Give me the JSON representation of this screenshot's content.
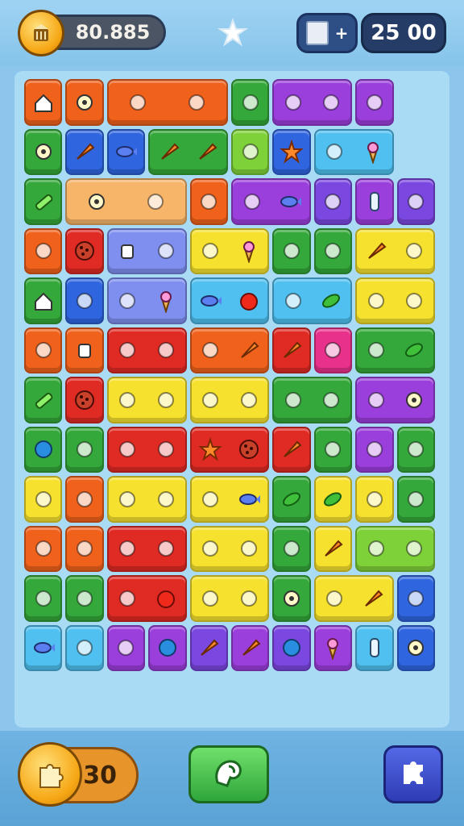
{
  "header": {
    "coins": "80.885",
    "book_count": "+",
    "score": "25 00",
    "coin_icon": "coin-basket-icon",
    "star_icon": "puzzle-star-icon",
    "book_icon": "book-icon"
  },
  "footer": {
    "hint_count": "30",
    "hint_icon": "puzzle-piece-icon",
    "shuffle_icon": "glove-icon",
    "magic_icon": "puzzle-icon"
  },
  "colors": {
    "orange": "#f0621c",
    "red": "#e02a24",
    "green": "#34a83a",
    "lime": "#7fd13a",
    "yellow": "#f5e12e",
    "purple": "#9b3fdc",
    "violet": "#7a47e0",
    "blue": "#2f66e0",
    "sky": "#4fc0ef",
    "peach": "#f7b56a",
    "periwinkle": "#7e8ff0",
    "pink": "#e8318a"
  },
  "board": {
    "rows": [
      [
        [
          "orange",
          1,
          "house-icon"
        ],
        [
          "orange",
          1,
          "gear-icon"
        ],
        [
          "orange",
          3,
          "robot-icon",
          "bar-icon"
        ],
        [
          "green",
          1,
          "apple-icon"
        ],
        [
          "purple",
          2,
          "lemon-icon",
          "wand-icon"
        ],
        [
          "purple",
          1,
          "trophy-icon"
        ]
      ],
      [
        [
          "green",
          1,
          "gear-icon"
        ],
        [
          "blue",
          1,
          "carrot-icon"
        ],
        [
          "blue",
          1,
          "fish-icon"
        ],
        [
          "green",
          2,
          "carrot-icon",
          "carrot-icon"
        ],
        [
          "lime",
          1,
          "dino-icon"
        ],
        [
          "blue",
          1,
          "star-icon"
        ],
        [
          "sky",
          2,
          "cat-icon",
          "icecream-icon"
        ]
      ],
      [
        [
          "green",
          1,
          "stick-icon"
        ],
        [
          "peach",
          3,
          "gear-icon",
          "tube-icon"
        ],
        [
          "orange",
          1,
          "shell-icon"
        ],
        [
          "purple",
          2,
          "flag-icon",
          "fish-icon"
        ],
        [
          "violet",
          1,
          "bird-icon"
        ],
        [
          "purple",
          1,
          "bottle-icon"
        ],
        [
          "violet",
          1,
          "cat-icon"
        ]
      ],
      [
        [
          "orange",
          1,
          "bandage-icon"
        ],
        [
          "red",
          1,
          "cookie-icon"
        ],
        [
          "periwinkle",
          2,
          "cup-icon",
          "pill-icon"
        ],
        [
          "yellow",
          2,
          "bug-icon",
          "icecream-icon"
        ],
        [
          "green",
          1,
          "ant-icon"
        ],
        [
          "green",
          1,
          "strawberry-icon"
        ],
        [
          "yellow",
          2,
          "carrot-icon",
          "balloon-icon"
        ]
      ],
      [
        [
          "green",
          1,
          "house-icon"
        ],
        [
          "blue",
          1,
          "jar-icon"
        ],
        [
          "periwinkle",
          2,
          "chili-icon",
          "icecream-icon"
        ],
        [
          "sky",
          2,
          "fish-icon",
          "tomato-icon"
        ],
        [
          "sky",
          2,
          "dino-icon",
          "leaf-icon"
        ],
        [
          "yellow",
          2,
          "key-icon",
          "sock-icon"
        ]
      ],
      [
        [
          "orange",
          1,
          "tube-icon"
        ],
        [
          "orange",
          1,
          "cup-icon"
        ],
        [
          "red",
          2,
          "door-icon",
          "sun-icon"
        ],
        [
          "orange",
          2,
          "puzzle-icon",
          "carrot-icon"
        ],
        [
          "red",
          1,
          "carrot-icon"
        ],
        [
          "pink",
          1,
          "bird-icon"
        ],
        [
          "green",
          2,
          "broccoli-icon",
          "leaf-icon"
        ]
      ],
      [
        [
          "green",
          1,
          "stick-icon"
        ],
        [
          "red",
          1,
          "cookie-icon"
        ],
        [
          "yellow",
          2,
          "cheese-icon",
          "box-icon"
        ],
        [
          "yellow",
          2,
          "brush-icon",
          "shoe-icon"
        ],
        [
          "green",
          2,
          "pill-icon",
          "egg-icon"
        ],
        [
          "purple",
          2,
          "skull-icon",
          "gear-icon"
        ]
      ],
      [
        [
          "green",
          1,
          "ball-icon"
        ],
        [
          "green",
          1,
          "eye-icon"
        ],
        [
          "red",
          2,
          "pot-icon",
          "bird-icon"
        ],
        [
          "red",
          2,
          "star-icon",
          "cookie-icon"
        ],
        [
          "red",
          1,
          "carrot-icon"
        ],
        [
          "green",
          1,
          "tree-icon"
        ],
        [
          "purple",
          1,
          "music-icon"
        ],
        [
          "green",
          1,
          "cube-icon"
        ]
      ],
      [
        [
          "yellow",
          1,
          "tube-icon"
        ],
        [
          "orange",
          1,
          "hammer-icon"
        ],
        [
          "yellow",
          2,
          "cheese-icon",
          "brush-icon"
        ],
        [
          "yellow",
          2,
          "pepper-icon",
          "fish-icon"
        ],
        [
          "green",
          1,
          "leaf-icon"
        ],
        [
          "yellow",
          1,
          "leaf-icon"
        ],
        [
          "yellow",
          1,
          "gem-icon"
        ],
        [
          "green",
          1,
          "chili-icon"
        ]
      ],
      [
        [
          "orange",
          1,
          "egg-icon"
        ],
        [
          "orange",
          1,
          "radio-icon"
        ],
        [
          "red",
          2,
          "door-icon",
          "card-icon"
        ],
        [
          "yellow",
          2,
          "brush-icon",
          "bone-icon"
        ],
        [
          "green",
          1,
          "pepper-icon"
        ],
        [
          "yellow",
          1,
          "carrot-icon"
        ],
        [
          "lime",
          2,
          "ribbon-icon",
          "puzzle-icon"
        ]
      ],
      [
        [
          "green",
          1,
          "lobster-icon"
        ],
        [
          "green",
          1,
          "blob-icon"
        ],
        [
          "red",
          2,
          "cherry-icon",
          "tomato-icon"
        ],
        [
          "yellow",
          2,
          "pencil-icon",
          "lemon-icon"
        ],
        [
          "green",
          1,
          "gear-icon"
        ],
        [
          "yellow",
          2,
          "bone-icon",
          "carrot-icon"
        ],
        [
          "blue",
          1,
          "card-icon"
        ]
      ],
      [
        [
          "sky",
          1,
          "fish-icon"
        ],
        [
          "sky",
          1,
          "phone-icon"
        ],
        [
          "purple",
          1,
          "jar-icon"
        ],
        [
          "purple",
          1,
          "ball-icon"
        ],
        [
          "violet",
          1,
          "carrot-icon"
        ],
        [
          "purple",
          1,
          "carrot-icon"
        ],
        [
          "violet",
          1,
          "ball-icon"
        ],
        [
          "purple",
          1,
          "icecream-icon"
        ],
        [
          "sky",
          1,
          "bottle-icon"
        ],
        [
          "blue",
          1,
          "gear-icon"
        ]
      ]
    ]
  }
}
